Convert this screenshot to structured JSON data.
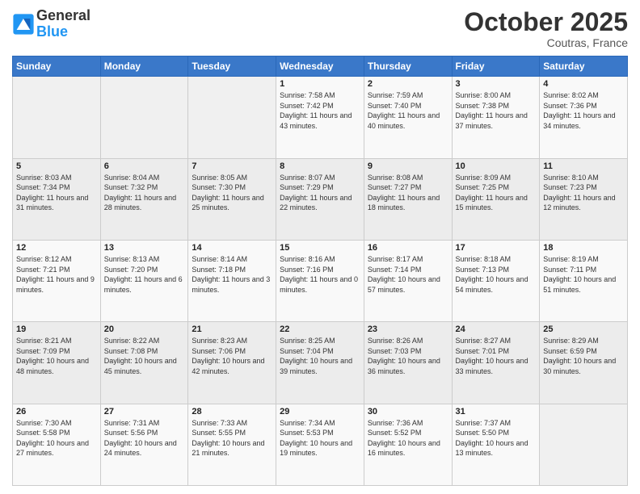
{
  "header": {
    "logo_general": "General",
    "logo_blue": "Blue",
    "month": "October 2025",
    "location": "Coutras, France"
  },
  "days_of_week": [
    "Sunday",
    "Monday",
    "Tuesday",
    "Wednesday",
    "Thursday",
    "Friday",
    "Saturday"
  ],
  "weeks": [
    [
      {
        "day": "",
        "info": ""
      },
      {
        "day": "",
        "info": ""
      },
      {
        "day": "",
        "info": ""
      },
      {
        "day": "1",
        "sunrise": "7:58 AM",
        "sunset": "7:42 PM",
        "daylight": "11 hours and 43 minutes."
      },
      {
        "day": "2",
        "sunrise": "7:59 AM",
        "sunset": "7:40 PM",
        "daylight": "11 hours and 40 minutes."
      },
      {
        "day": "3",
        "sunrise": "8:00 AM",
        "sunset": "7:38 PM",
        "daylight": "11 hours and 37 minutes."
      },
      {
        "day": "4",
        "sunrise": "8:02 AM",
        "sunset": "7:36 PM",
        "daylight": "11 hours and 34 minutes."
      }
    ],
    [
      {
        "day": "5",
        "sunrise": "8:03 AM",
        "sunset": "7:34 PM",
        "daylight": "11 hours and 31 minutes."
      },
      {
        "day": "6",
        "sunrise": "8:04 AM",
        "sunset": "7:32 PM",
        "daylight": "11 hours and 28 minutes."
      },
      {
        "day": "7",
        "sunrise": "8:05 AM",
        "sunset": "7:30 PM",
        "daylight": "11 hours and 25 minutes."
      },
      {
        "day": "8",
        "sunrise": "8:07 AM",
        "sunset": "7:29 PM",
        "daylight": "11 hours and 22 minutes."
      },
      {
        "day": "9",
        "sunrise": "8:08 AM",
        "sunset": "7:27 PM",
        "daylight": "11 hours and 18 minutes."
      },
      {
        "day": "10",
        "sunrise": "8:09 AM",
        "sunset": "7:25 PM",
        "daylight": "11 hours and 15 minutes."
      },
      {
        "day": "11",
        "sunrise": "8:10 AM",
        "sunset": "7:23 PM",
        "daylight": "11 hours and 12 minutes."
      }
    ],
    [
      {
        "day": "12",
        "sunrise": "8:12 AM",
        "sunset": "7:21 PM",
        "daylight": "11 hours and 9 minutes."
      },
      {
        "day": "13",
        "sunrise": "8:13 AM",
        "sunset": "7:20 PM",
        "daylight": "11 hours and 6 minutes."
      },
      {
        "day": "14",
        "sunrise": "8:14 AM",
        "sunset": "7:18 PM",
        "daylight": "11 hours and 3 minutes."
      },
      {
        "day": "15",
        "sunrise": "8:16 AM",
        "sunset": "7:16 PM",
        "daylight": "11 hours and 0 minutes."
      },
      {
        "day": "16",
        "sunrise": "8:17 AM",
        "sunset": "7:14 PM",
        "daylight": "10 hours and 57 minutes."
      },
      {
        "day": "17",
        "sunrise": "8:18 AM",
        "sunset": "7:13 PM",
        "daylight": "10 hours and 54 minutes."
      },
      {
        "day": "18",
        "sunrise": "8:19 AM",
        "sunset": "7:11 PM",
        "daylight": "10 hours and 51 minutes."
      }
    ],
    [
      {
        "day": "19",
        "sunrise": "8:21 AM",
        "sunset": "7:09 PM",
        "daylight": "10 hours and 48 minutes."
      },
      {
        "day": "20",
        "sunrise": "8:22 AM",
        "sunset": "7:08 PM",
        "daylight": "10 hours and 45 minutes."
      },
      {
        "day": "21",
        "sunrise": "8:23 AM",
        "sunset": "7:06 PM",
        "daylight": "10 hours and 42 minutes."
      },
      {
        "day": "22",
        "sunrise": "8:25 AM",
        "sunset": "7:04 PM",
        "daylight": "10 hours and 39 minutes."
      },
      {
        "day": "23",
        "sunrise": "8:26 AM",
        "sunset": "7:03 PM",
        "daylight": "10 hours and 36 minutes."
      },
      {
        "day": "24",
        "sunrise": "8:27 AM",
        "sunset": "7:01 PM",
        "daylight": "10 hours and 33 minutes."
      },
      {
        "day": "25",
        "sunrise": "8:29 AM",
        "sunset": "6:59 PM",
        "daylight": "10 hours and 30 minutes."
      }
    ],
    [
      {
        "day": "26",
        "sunrise": "7:30 AM",
        "sunset": "5:58 PM",
        "daylight": "10 hours and 27 minutes."
      },
      {
        "day": "27",
        "sunrise": "7:31 AM",
        "sunset": "5:56 PM",
        "daylight": "10 hours and 24 minutes."
      },
      {
        "day": "28",
        "sunrise": "7:33 AM",
        "sunset": "5:55 PM",
        "daylight": "10 hours and 21 minutes."
      },
      {
        "day": "29",
        "sunrise": "7:34 AM",
        "sunset": "5:53 PM",
        "daylight": "10 hours and 19 minutes."
      },
      {
        "day": "30",
        "sunrise": "7:36 AM",
        "sunset": "5:52 PM",
        "daylight": "10 hours and 16 minutes."
      },
      {
        "day": "31",
        "sunrise": "7:37 AM",
        "sunset": "5:50 PM",
        "daylight": "10 hours and 13 minutes."
      },
      {
        "day": "",
        "info": ""
      }
    ]
  ]
}
